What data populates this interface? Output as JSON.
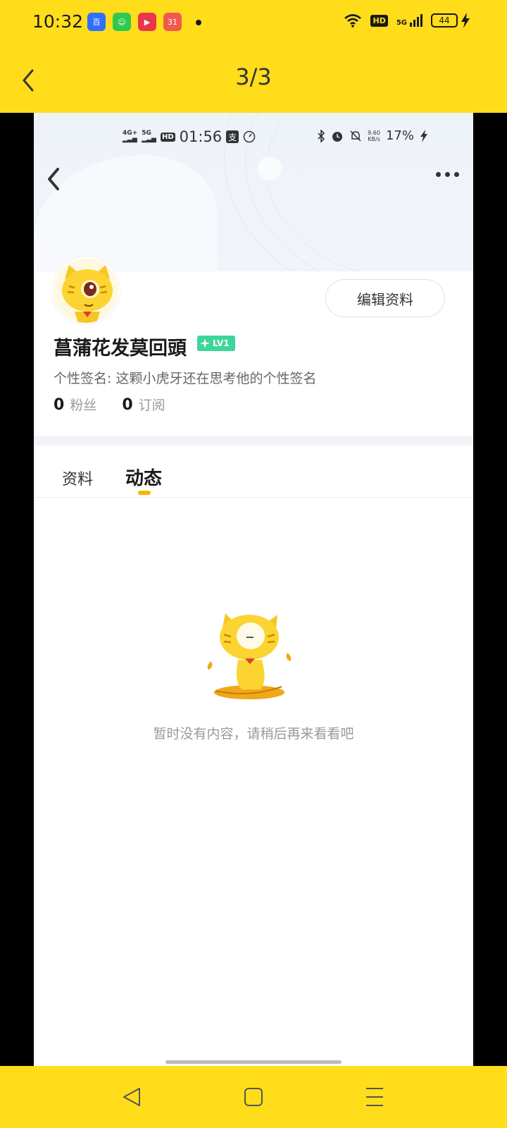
{
  "status_bar": {
    "time": "10:32",
    "app_icons": [
      {
        "name": "baidu-app-icon",
        "label": "百",
        "color": "#2f6fff"
      },
      {
        "name": "gift-app-icon",
        "label": "☺",
        "color": "#2ec94f"
      },
      {
        "name": "camera-app-icon",
        "label": "▶",
        "color": "#e8374b"
      },
      {
        "name": "calendar-app-icon",
        "label": "31",
        "color": "#f05a4e"
      }
    ],
    "hd_label": "HD",
    "network_label": "5G",
    "battery": "44"
  },
  "viewer": {
    "page_indicator": "3/3"
  },
  "inner_status": {
    "sig1": "4G+",
    "sig2": "5G",
    "hd": "HD",
    "time": "01:56",
    "speed_value": "9.60",
    "speed_unit": "KB/s",
    "battery": "17%"
  },
  "profile": {
    "username": "菖蒲花发莫回頭",
    "level": "LV1",
    "signature": "个性签名: 这颗小虎牙还在思考他的个性签名",
    "edit_button": "编辑资料",
    "stats": [
      {
        "count": "0",
        "label": "粉丝"
      },
      {
        "count": "0",
        "label": "订阅"
      }
    ]
  },
  "tabs": [
    {
      "label": "资料"
    },
    {
      "label": "动态"
    }
  ],
  "empty_state": {
    "message": "暂时没有内容，请稍后再来看看吧"
  },
  "colors": {
    "brand_yellow": "#ffdd1a",
    "level_green": "#3dd59a",
    "tab_indicator": "#f5b700"
  }
}
